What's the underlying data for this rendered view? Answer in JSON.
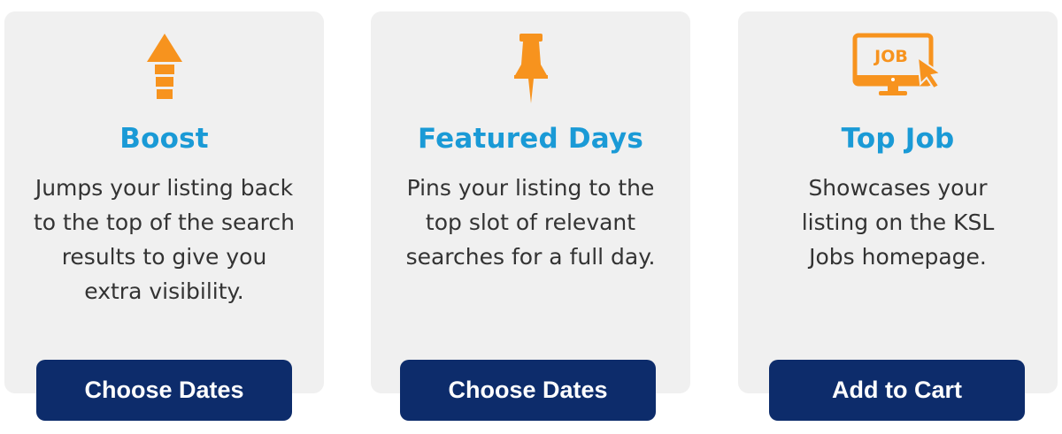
{
  "colors": {
    "card_background": "#f0f0f0",
    "title_blue": "#1a9ad6",
    "icon_orange": "#f7931e",
    "button_navy": "#0d2c6b",
    "body_text": "#333333"
  },
  "cards": [
    {
      "icon": "boost-arrow-icon",
      "title": "Boost",
      "description": "Jumps your listing back to the top of the search results to give you extra visibility.",
      "button_label": "Choose Dates"
    },
    {
      "icon": "pushpin-icon",
      "title": "Featured Days",
      "description": "Pins your listing to the top slot of relevant searches for a full day.",
      "button_label": "Choose Dates"
    },
    {
      "icon": "job-monitor-icon",
      "icon_text": "JOB",
      "title": "Top Job",
      "description": "Showcases your listing on the KSL Jobs homepage.",
      "button_label": "Add to Cart"
    }
  ]
}
